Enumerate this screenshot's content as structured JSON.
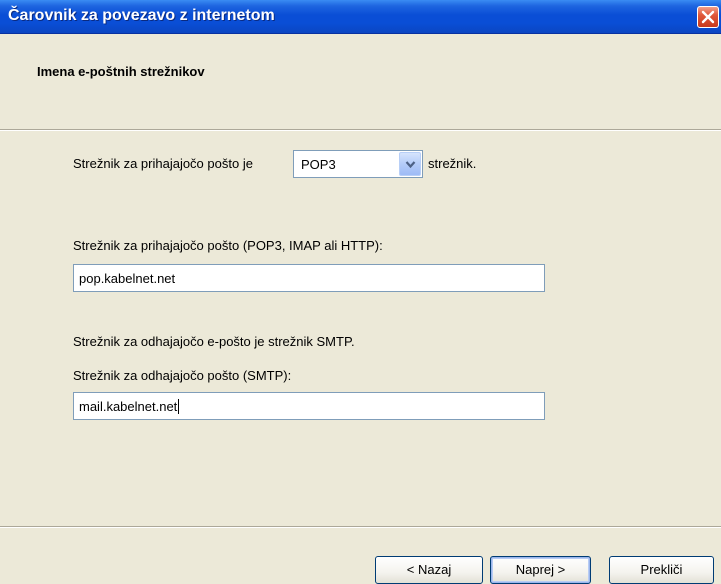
{
  "window": {
    "title": "Čarovnik za povezavo z internetom"
  },
  "header": {
    "title": "Imena e-poštnih strežnikov"
  },
  "incoming_type": {
    "prefix_label": "Strežnik za prihajajočo pošto je",
    "selected": "POP3",
    "suffix_label": "strežnik."
  },
  "incoming_server": {
    "label": "Strežnik za prihajajočo pošto (POP3, IMAP ali HTTP):",
    "value": "pop.kabelnet.net"
  },
  "outgoing_info": "Strežnik za odhajajočo e-pošto je strežnik SMTP.",
  "outgoing_server": {
    "label": "Strežnik za odhajajočo pošto (SMTP):",
    "value": "mail.kabelnet.net"
  },
  "buttons": {
    "back": "< Nazaj",
    "next": "Naprej >",
    "cancel": "Prekliči"
  },
  "icons": {
    "close": "close-icon",
    "dropdown": "chevron-down-icon"
  },
  "colors": {
    "titlebar": "#0A4ED6",
    "dialog_bg": "#ECE9D8",
    "close_button": "#E0583A",
    "input_border": "#7F9DB9"
  }
}
